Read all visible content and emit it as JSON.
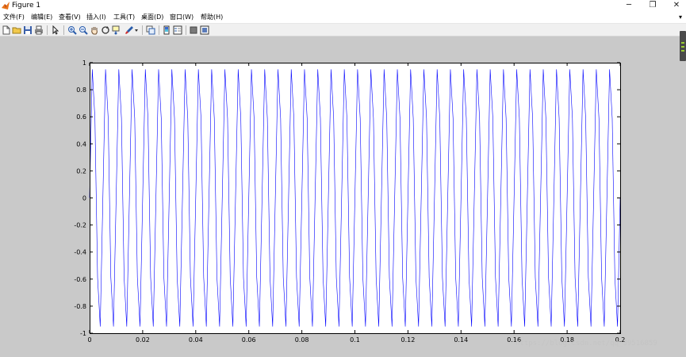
{
  "window": {
    "title": "Figure 1",
    "controls": {
      "minimize": "─",
      "maximize": "❐",
      "close": "✕"
    }
  },
  "menu": {
    "items": [
      "文件(F)",
      "编辑(E)",
      "查看(V)",
      "插入(I)",
      "工具(T)",
      "桌面(D)",
      "窗口(W)",
      "帮助(H)"
    ],
    "overflow_arrow": "▾"
  },
  "toolbar": {
    "icons": [
      "new-file-icon",
      "open-folder-icon",
      "save-icon",
      "print-icon",
      "pointer-icon",
      "zoom-in-icon",
      "zoom-out-icon",
      "pan-hand-icon",
      "rotate-3d-icon",
      "data-cursor-icon",
      "brush-icon",
      "brush-dropdown-icon",
      "link-plot-icon",
      "colorbar-icon",
      "legend-icon",
      "hide-plot-tools-icon",
      "show-plot-tools-icon"
    ]
  },
  "watermark": "https://blog.csdn.net/qq_39516859",
  "chart_data": {
    "type": "line",
    "title": "",
    "xlabel": "",
    "ylabel": "",
    "xlim": [
      0,
      0.2
    ],
    "ylim": [
      -1,
      1
    ],
    "xticks": [
      0,
      0.02,
      0.04,
      0.06,
      0.08,
      0.1,
      0.12,
      0.14,
      0.16,
      0.18,
      0.2
    ],
    "yticks": [
      -1,
      -0.8,
      -0.6,
      -0.4,
      -0.2,
      0,
      0.2,
      0.4,
      0.6,
      0.8,
      1
    ],
    "xtick_labels": [
      "0",
      "0.02",
      "0.04",
      "0.06",
      "0.08",
      "0.1",
      "0.12",
      "0.14",
      "0.16",
      "0.18",
      "0.2"
    ],
    "ytick_labels": [
      "-1",
      "-0.8",
      "-0.6",
      "-0.4",
      "-0.2",
      "0",
      "0.2",
      "0.4",
      "0.6",
      "0.8",
      "1"
    ],
    "grid": false,
    "series": [
      {
        "function": "sin",
        "frequency_hz": 200,
        "amplitude": 1,
        "sample_interval": 0.001,
        "color": "#0000ff"
      }
    ]
  }
}
